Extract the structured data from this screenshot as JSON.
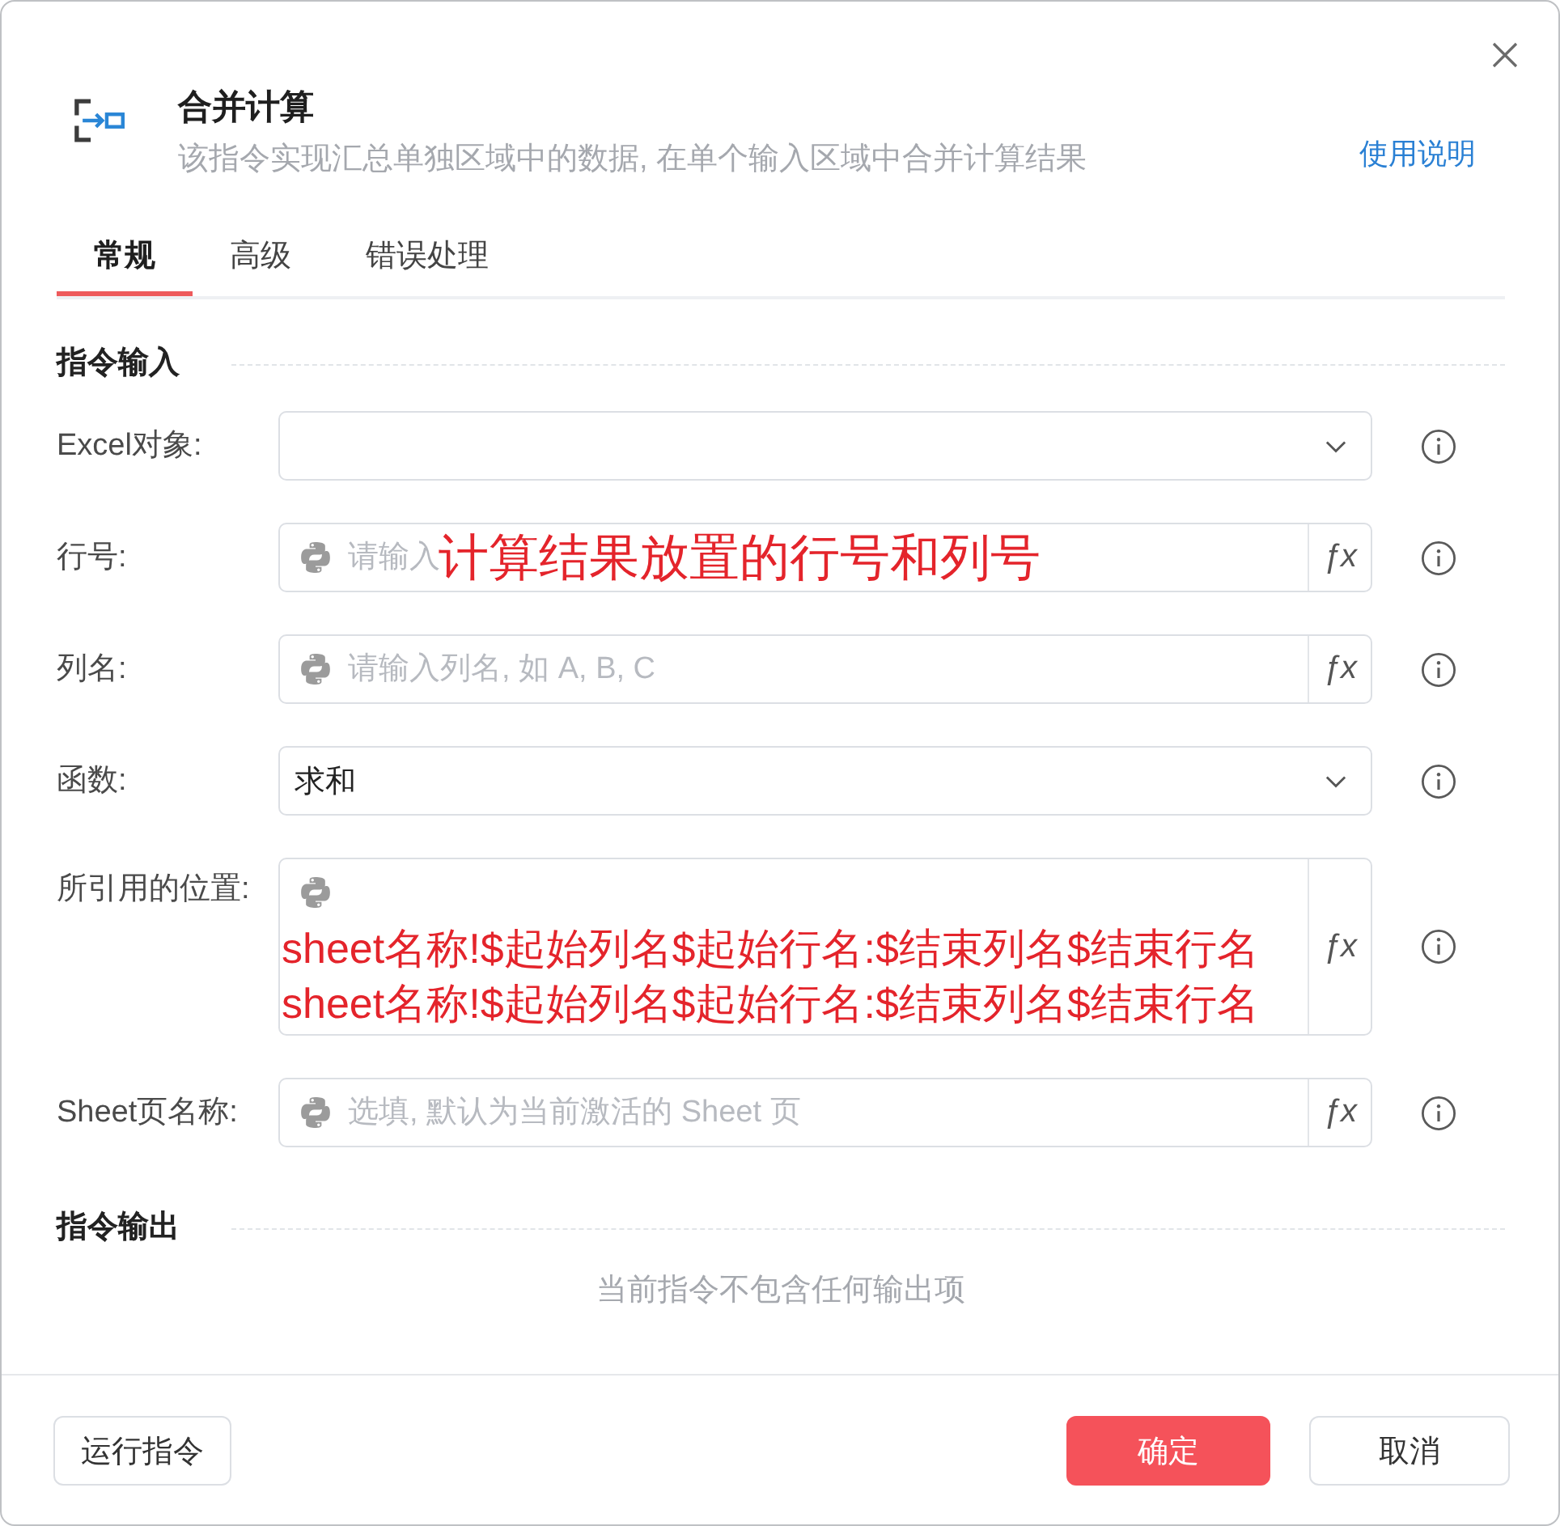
{
  "dialog": {
    "title": "合并计算",
    "description": "该指令实现汇总单独区域中的数据, 在单个输入区域中合并计算结果",
    "help_link": "使用说明"
  },
  "tabs": [
    {
      "label": "常规",
      "selected": true
    },
    {
      "label": "高级",
      "selected": false
    },
    {
      "label": "错误处理",
      "selected": false
    }
  ],
  "input_section": {
    "title": "指令输入",
    "fields": [
      {
        "kind": "select",
        "label": "Excel对象:"
      },
      {
        "kind": "expression",
        "label": "行号:",
        "placeholder": "请输入",
        "formula_button": "ƒx",
        "annotation": "计算结果放置的行号和列号"
      },
      {
        "kind": "expression",
        "label": "列名:",
        "placeholder": "请输入列名, 如 A, B, C",
        "formula_button": "ƒx"
      },
      {
        "kind": "select",
        "label": "函数:",
        "value": "求和"
      },
      {
        "kind": "multiline",
        "label": "所引用的位置:",
        "annotation_lines": [
          "sheet名称!$起始列名$起始行名:$结束列名$结束行名",
          "sheet名称!$起始列名$起始行名:$结束列名$结束行名"
        ],
        "formula_button": "ƒx"
      },
      {
        "kind": "expression",
        "label": "Sheet页名称:",
        "placeholder": "选填, 默认为当前激活的 Sheet 页",
        "formula_button": "ƒx"
      }
    ]
  },
  "output_section": {
    "title": "指令输出",
    "empty_text": "当前指令不包含任何输出项"
  },
  "footer": {
    "left_buttons": [
      {
        "label": "运行指令",
        "kind": "secondary"
      }
    ],
    "right_buttons": [
      {
        "label": "确定",
        "kind": "primary"
      },
      {
        "label": "取消",
        "kind": "secondary"
      }
    ]
  }
}
